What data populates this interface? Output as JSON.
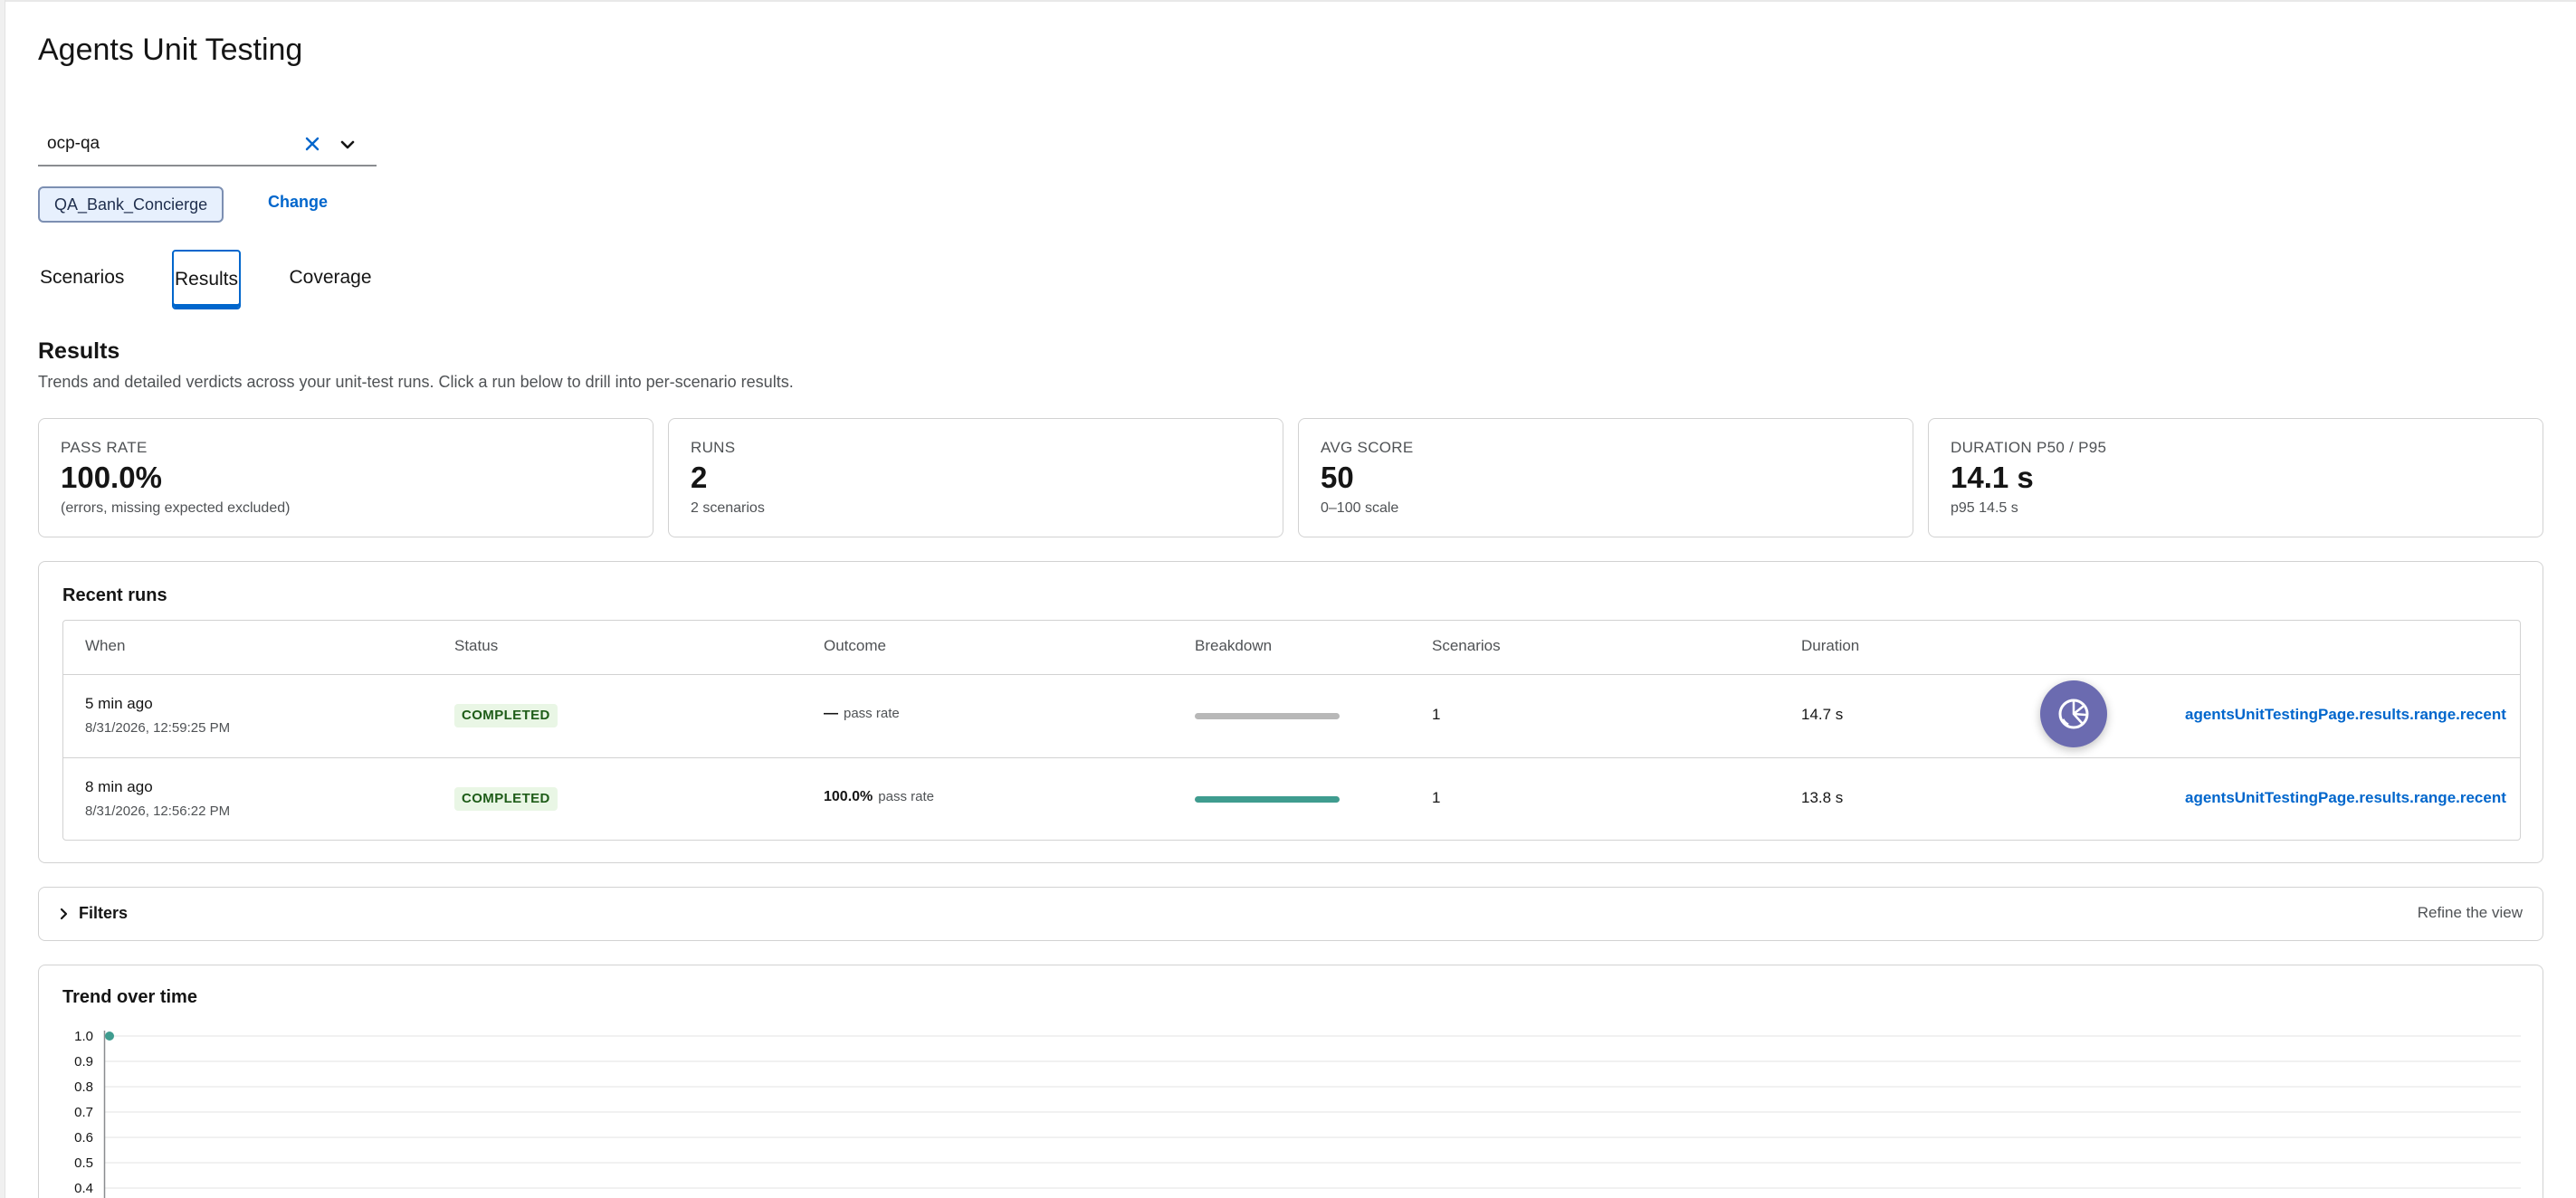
{
  "page_title": "Agents Unit Testing",
  "namespace_select": {
    "value": "ocp-qa"
  },
  "agent": {
    "name": "QA_Bank_Concierge",
    "change_label": "Change"
  },
  "tabs": [
    {
      "label": "Scenarios",
      "active": false
    },
    {
      "label": "Results",
      "active": true
    },
    {
      "label": "Coverage",
      "active": false
    }
  ],
  "results": {
    "title": "Results",
    "description": "Trends and detailed verdicts across your unit-test runs. Click a run below to drill into per-scenario results."
  },
  "kpis": [
    {
      "label": "PASS RATE",
      "value": "100.0%",
      "sub": "(errors, missing expected excluded)"
    },
    {
      "label": "RUNS",
      "value": "2",
      "sub": "2 scenarios"
    },
    {
      "label": "AVG SCORE",
      "value": "50",
      "sub": "0–100 scale"
    },
    {
      "label": "DURATION P50 / P95",
      "value": "14.1 s",
      "sub": "p95 14.5 s"
    }
  ],
  "recent_runs": {
    "title": "Recent runs",
    "columns": [
      "When",
      "Status",
      "Outcome",
      "Breakdown",
      "Scenarios",
      "Duration"
    ],
    "rows": [
      {
        "when": "5 min ago",
        "timestamp": "8/31/2026, 12:59:25 PM",
        "status": "COMPLETED",
        "outcome_value": "—",
        "outcome_label": "pass rate",
        "breakdown_pass_fraction": 0,
        "scenarios": "1",
        "duration": "14.7 s",
        "link": "agentsUnitTestingPage.results.range.recent"
      },
      {
        "when": "8 min ago",
        "timestamp": "8/31/2026, 12:56:22 PM",
        "status": "COMPLETED",
        "outcome_value": "100.0%",
        "outcome_label": "pass rate",
        "breakdown_pass_fraction": 1,
        "scenarios": "1",
        "duration": "13.8 s",
        "link": "agentsUnitTestingPage.results.range.recent"
      }
    ]
  },
  "filters": {
    "title": "Filters",
    "hint": "Refine the view"
  },
  "trend": {
    "title": "Trend over time"
  },
  "chart_data": {
    "type": "line",
    "title": "Trend over time",
    "xlabel": "",
    "ylabel": "",
    "ylim": [
      0.4,
      1.0
    ],
    "y_ticks": [
      "1.0",
      "0.9",
      "0.8",
      "0.7",
      "0.6",
      "0.5",
      "0.4"
    ],
    "grid": true,
    "series": [
      {
        "color": "#3f9c8f",
        "points": [
          {
            "x": 0,
            "y": 1.0
          }
        ]
      }
    ]
  },
  "colors": {
    "accent": "#0066cc",
    "success_bg": "#e9f6e5",
    "success_text": "#1e5c18",
    "pass_bar": "#3f9c8f",
    "neutral_bar": "#b8b8b8",
    "fab": "#6b6bb0"
  },
  "icons": {
    "clear": "close-icon",
    "dropdown": "chevron-down-icon",
    "filters_toggle": "chevron-right-icon",
    "fab": "assistant-icon"
  }
}
